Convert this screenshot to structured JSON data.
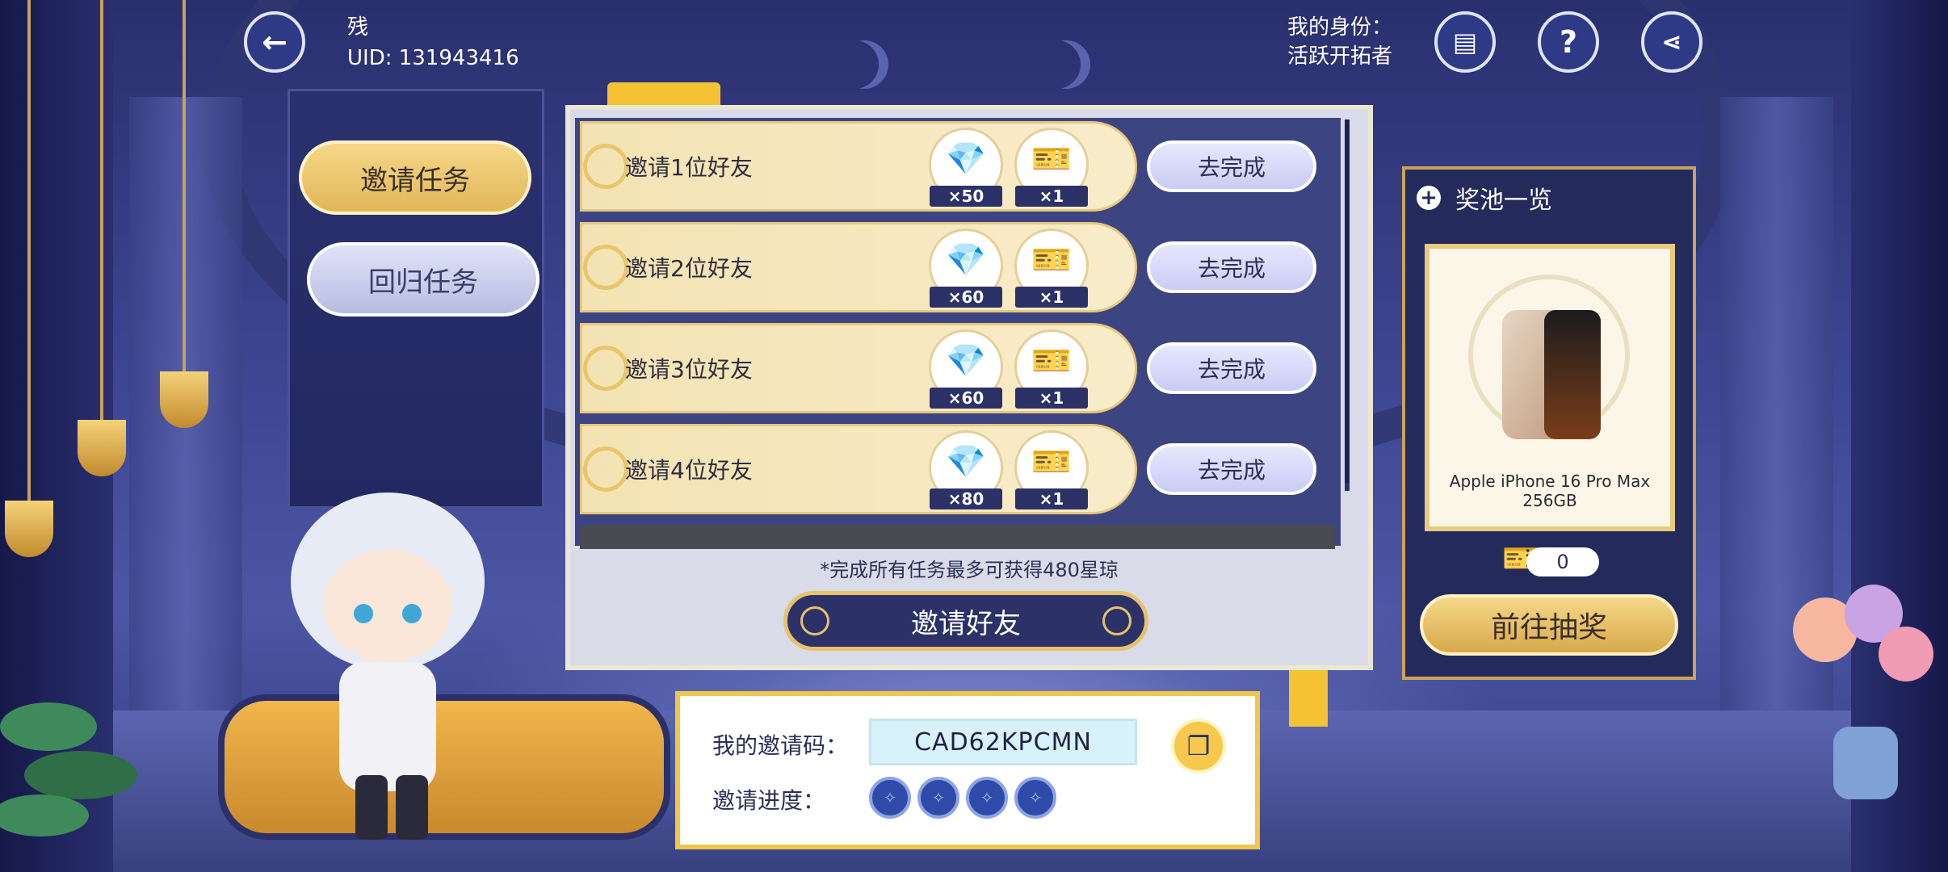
{
  "header": {
    "player_name": "残",
    "uid": "UID: 131943416",
    "identity_label": "我的身份：",
    "identity_value": "活跃开拓者"
  },
  "tabs": [
    {
      "label": "邀请任务",
      "active": true
    },
    {
      "label": "回归任务",
      "active": false
    }
  ],
  "tasks": [
    {
      "label": "邀请1位好友",
      "rewards": [
        {
          "icon": "stellar-jade-icon",
          "qty": "×50"
        },
        {
          "icon": "pass-ticket-icon",
          "qty": "×1"
        }
      ],
      "button": "去完成"
    },
    {
      "label": "邀请2位好友",
      "rewards": [
        {
          "icon": "stellar-jade-icon",
          "qty": "×60"
        },
        {
          "icon": "pass-ticket-icon",
          "qty": "×1"
        }
      ],
      "button": "去完成"
    },
    {
      "label": "邀请3位好友",
      "rewards": [
        {
          "icon": "stellar-jade-icon",
          "qty": "×60"
        },
        {
          "icon": "pass-ticket-icon",
          "qty": "×1"
        }
      ],
      "button": "去完成"
    },
    {
      "label": "邀请4位好友",
      "rewards": [
        {
          "icon": "stellar-jade-icon",
          "qty": "×80"
        },
        {
          "icon": "pass-ticket-icon",
          "qty": "×1"
        }
      ],
      "button": "去完成"
    }
  ],
  "board": {
    "note": "*完成所有任务最多可获得480星琼",
    "invite_button": "邀请好友"
  },
  "invite_code": {
    "label": "我的邀请码：",
    "value": "CAD62KPCMN",
    "progress_label": "邀请进度：",
    "progress_slots": 4,
    "progress_filled": 0
  },
  "prize_pool": {
    "title": "奖池一览",
    "prize_name": "Apple iPhone 16 Pro Max 256GB",
    "ticket_count": "0",
    "draw_button": "前往抽奖"
  },
  "colors": {
    "gold": "#f0c64c",
    "navy": "#2c3268",
    "card": "#f3e3b3"
  }
}
